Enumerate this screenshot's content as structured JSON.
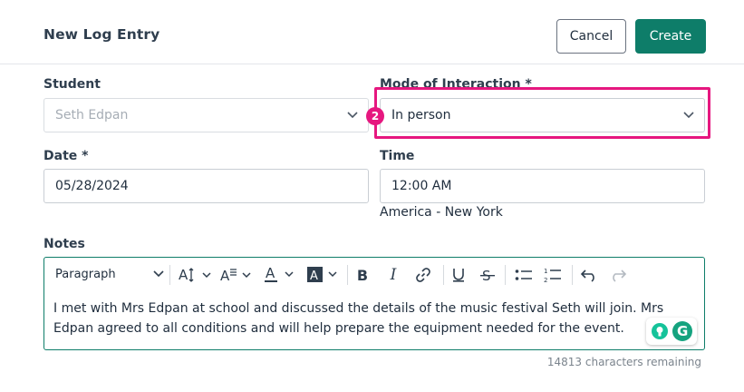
{
  "header": {
    "title": "New Log Entry",
    "cancel_label": "Cancel",
    "create_label": "Create"
  },
  "student": {
    "label": "Student",
    "value": "Seth Edpan"
  },
  "mode": {
    "label": "Mode of Interaction *",
    "value": "In person",
    "badge": "2"
  },
  "date": {
    "label": "Date *",
    "value": "05/28/2024"
  },
  "time": {
    "label": "Time",
    "value": "12:00 AM",
    "timezone": "America - New York"
  },
  "notes": {
    "label": "Notes",
    "paragraph_style": "Paragraph",
    "text": "I met with Mrs Edpan at school and discussed the details of the music festival Seth will join. Mrs Edpan agreed to all conditions and will help prepare the equipment needed for the event.",
    "remaining": "14813 characters remaining"
  },
  "colors": {
    "primary": "#0e7d69",
    "highlight": "#e6177f"
  },
  "icons": [
    "chevron-down-icon",
    "font-size-icon",
    "line-height-icon",
    "font-color-icon",
    "highlight-color-icon",
    "bold-icon",
    "italic-icon",
    "link-icon",
    "underline-icon",
    "strikethrough-icon",
    "bullet-list-icon",
    "numbered-list-icon",
    "undo-icon",
    "redo-icon",
    "grammarly-icon"
  ]
}
